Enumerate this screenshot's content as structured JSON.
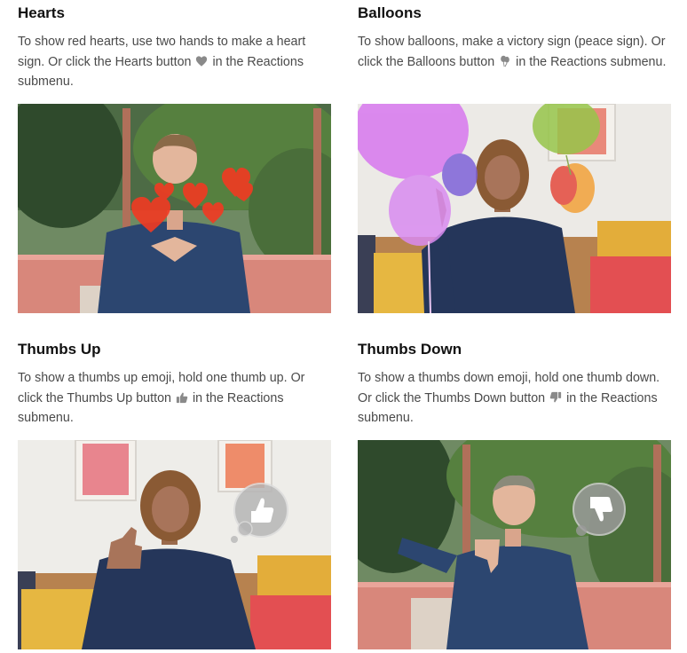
{
  "sections": [
    {
      "title": "Hearts",
      "text_before": "To show red hearts, use two hands to make a heart sign. Or click the Hearts button",
      "text_after": "in the Reactions submenu.",
      "icon": "heart-icon",
      "photo": "person making heart sign with red hearts floating"
    },
    {
      "title": "Balloons",
      "text_before": "To show balloons, make a victory sign (peace sign). Or click the Balloons button",
      "text_after": "in the Reactions submenu.",
      "icon": "balloon-icon",
      "photo": "person making peace sign with balloons"
    },
    {
      "title": "Thumbs Up",
      "text_before": "To show a thumbs up emoji, hold one thumb up. Or click the Thumbs Up button",
      "text_after": "in the Reactions submenu.",
      "icon": "thumbs-up-icon",
      "photo": "person giving thumbs up with thumbs-up bubble"
    },
    {
      "title": "Thumbs Down",
      "text_before": "To show a thumbs down emoji, hold one thumb down. Or click the Thumbs Down button",
      "text_after": "in the Reactions submenu.",
      "icon": "thumbs-down-icon",
      "photo": "person giving thumbs down with thumbs-down bubble"
    }
  ],
  "colors": {
    "heading": "#111111",
    "body_text": "#4a4a4a",
    "icon_gray": "#8a8a8a",
    "heart_red": "#f23a22",
    "denim": "#2c4670",
    "couch_pink": "#d86b6b",
    "foliage": "#3e5a34"
  }
}
